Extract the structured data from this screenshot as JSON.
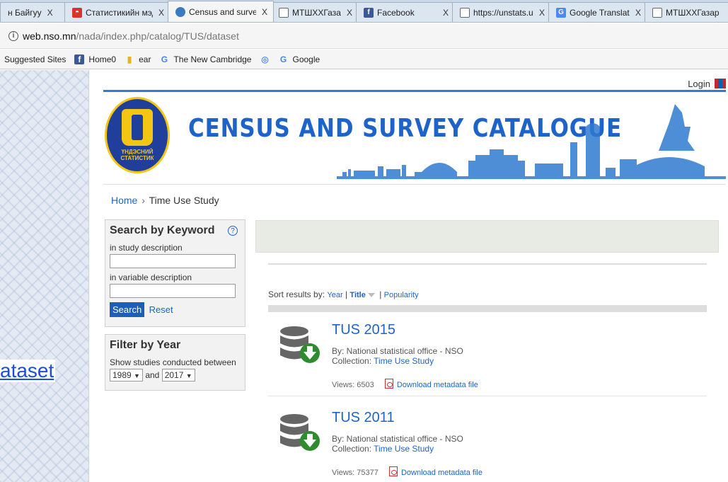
{
  "browser": {
    "tabs": [
      {
        "title": "н Байгуу",
        "favicon": "page-icon",
        "active": false
      },
      {
        "title": "Статистикийн мэд",
        "favicon": "red-site-icon",
        "active": false
      },
      {
        "title": "Census and survey",
        "favicon": "globe-icon",
        "active": true
      },
      {
        "title": "МТШХХГазар",
        "favicon": "page-icon",
        "active": false
      },
      {
        "title": "Facebook",
        "favicon": "facebook-icon",
        "active": false
      },
      {
        "title": "https://unstats.un",
        "favicon": "page-icon",
        "active": false
      },
      {
        "title": "Google Translate",
        "favicon": "translate-icon",
        "active": false
      },
      {
        "title": "МТШХХГазар",
        "favicon": "page-icon",
        "active": false
      }
    ],
    "close_glyph": "X",
    "address": {
      "host": "web.nso.mn",
      "path": "/nada/index.php/catalog/TUS/dataset"
    },
    "bookmarks": [
      {
        "label": "Suggested Sites",
        "icon": ""
      },
      {
        "label": "Home0",
        "icon": "facebook-icon"
      },
      {
        "label": "ear",
        "icon": "candle-icon"
      },
      {
        "label": "The New Cambridge",
        "icon": "google-icon"
      },
      {
        "label": "",
        "icon": "un-icon"
      },
      {
        "label": "Google",
        "icon": "google-icon"
      }
    ]
  },
  "page": {
    "side_link": "ataset",
    "login_label": "Login",
    "site_title": "CENSUS AND SURVEY CATALOGUE",
    "logo_text": [
      "ҮНДЭСНИЙ",
      "СТАТИСТИК"
    ],
    "breadcrumb": {
      "home": "Home",
      "separator": "›",
      "current": "Time Use Study"
    },
    "search_box": {
      "heading": "Search by Keyword",
      "help": "?",
      "study_label": "in study description",
      "study_value": "",
      "variable_label": "in variable description",
      "variable_value": "",
      "search_button": "Search",
      "reset_link": "Reset"
    },
    "filter_box": {
      "heading": "Filter by Year",
      "label": "Show studies conducted between",
      "from_year": "1989",
      "and_label": "and",
      "to_year": "2017"
    },
    "sort": {
      "label": "Sort results by:",
      "year": "Year",
      "title": "Title",
      "popularity": "Popularity",
      "separator": "|"
    },
    "studies": [
      {
        "title": "TUS 2015",
        "by": "By: National statistical office - NSO",
        "collection_label": "Collection:",
        "collection": "Time Use Study",
        "views": "Views: 6503",
        "download": "Download metadata file"
      },
      {
        "title": "TUS 2011",
        "by": "By: National statistical office - NSO",
        "collection_label": "Collection:",
        "collection": "Time Use Study",
        "views": "Views: 75377",
        "download": "Download metadata file"
      }
    ]
  },
  "colors": {
    "accent_blue": "#1e64c8",
    "rule_blue": "#2e7bd1",
    "download_green": "#2e8b2e"
  }
}
